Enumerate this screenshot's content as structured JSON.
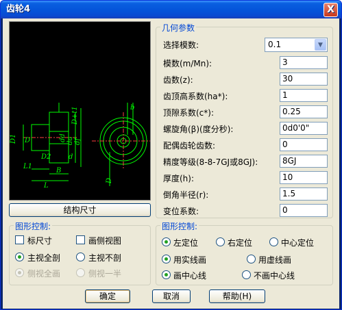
{
  "window": {
    "title": "齿轮4",
    "close_label": "X"
  },
  "drawing": {
    "dims": [
      "b",
      "D+t1",
      "D1",
      "D",
      "dd",
      "da",
      "df",
      "D2",
      "d",
      "L1",
      "B",
      "L",
      "D"
    ]
  },
  "structure_button": "结构尺寸",
  "geometry": {
    "title": "几何参数",
    "module_select": {
      "label": "选择模数:",
      "value": "0.1"
    },
    "fields": [
      {
        "label": "模数(m/Mn):",
        "value": "3"
      },
      {
        "label": "齿数(z):",
        "value": "30"
      },
      {
        "label": "齿顶高系数(ha*):",
        "value": "1"
      },
      {
        "label": "顶隙系数(c*):",
        "value": "0.25"
      },
      {
        "label": "螺旋角(β)(度分秒):",
        "value": "0d0'0\""
      },
      {
        "label": "配偶齿轮齿数:",
        "value": "0"
      },
      {
        "label": "精度等级(8-8-7GJ或8GJ):",
        "value": "8GJ"
      },
      {
        "label": "厚度(h):",
        "value": "10"
      },
      {
        "label": "倒角半径(r):",
        "value": "1.5"
      },
      {
        "label": "变位系数:",
        "value": "0"
      }
    ]
  },
  "shape_control_left": {
    "title": "图形控制:",
    "checkbox_dims": "标尺寸",
    "checkbox_side": "画侧视图",
    "radio_main_full": "主视全剖",
    "radio_main_none": "主视不剖",
    "radio_side_full": "侧视全画",
    "radio_side_half": "侧视一半"
  },
  "shape_control_right": {
    "title": "图形控制:",
    "radio_left": "左定位",
    "radio_right": "右定位",
    "radio_center": "中心定位",
    "radio_solid": "用实线画",
    "radio_dashed": "用虚线画",
    "radio_centerline": "画中心线",
    "radio_no_centerline": "不画中心线"
  },
  "buttons": {
    "ok": "确定",
    "cancel": "取消",
    "help": "帮助(H)"
  }
}
